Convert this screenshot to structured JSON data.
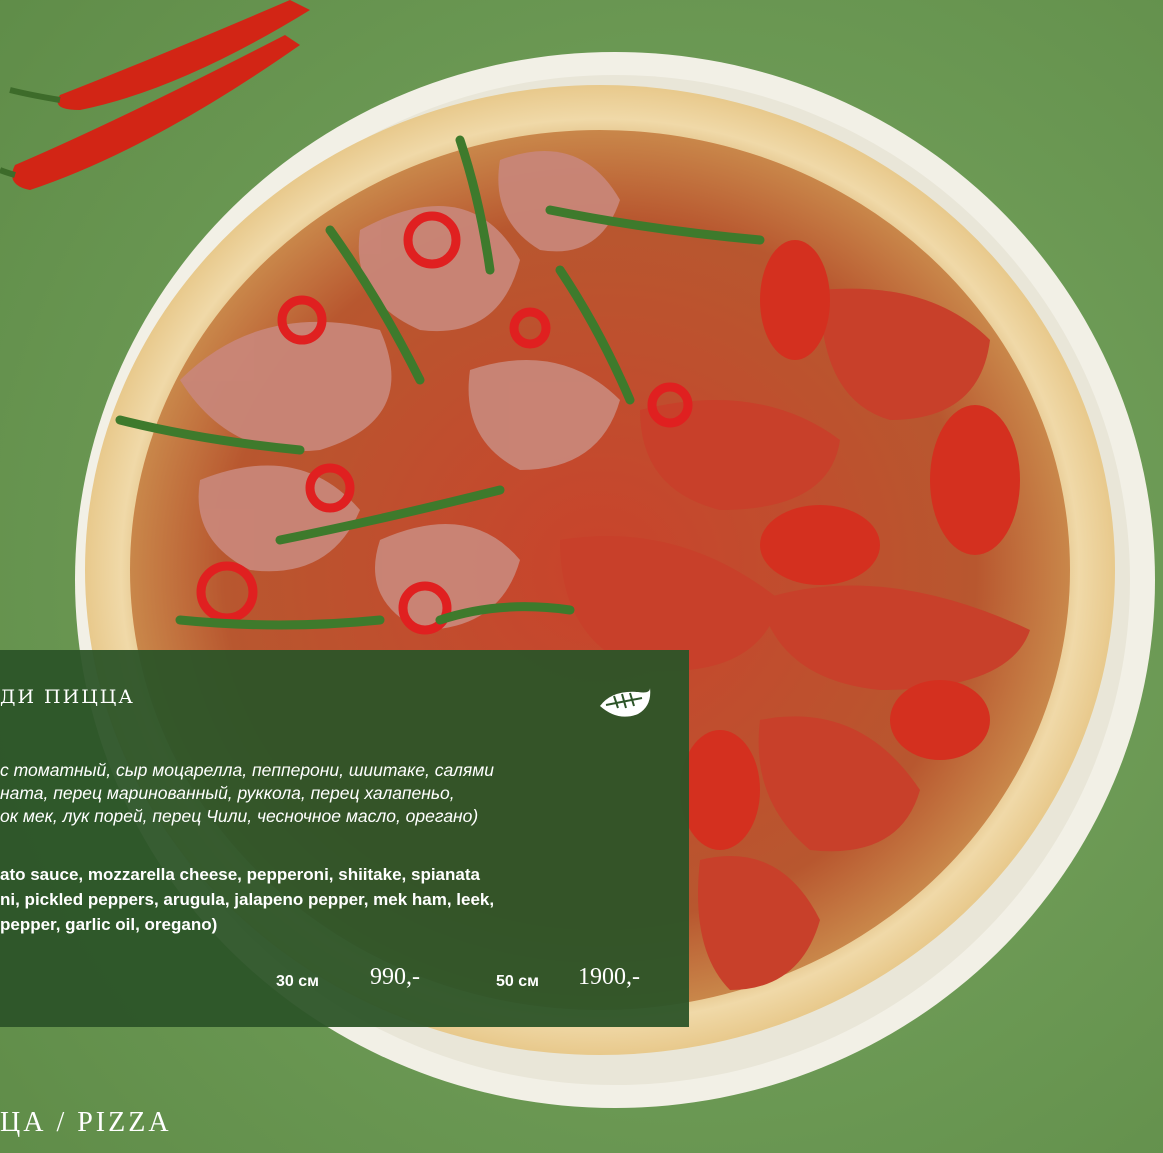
{
  "card": {
    "title": "ДИ ПИЦЦА",
    "leaf_icon": "leaf-icon",
    "description_ru": [
      "с томатный, сыр моцарелла, пепперони, шиитаке, салями",
      "ната, перец маринованный, руккола, перец халапеньо,",
      "ок мек, лук порей, перец Чили, чесночное масло, орегано)"
    ],
    "description_en": [
      "ato sauce, mozzarella cheese, pepperoni, shiitake, spianata",
      "ni, pickled peppers, arugula, jalapeno pepper, mek ham, leek,",
      "pepper, garlic oil, oregano)"
    ],
    "sizes": [
      {
        "label": "30 см",
        "price": "990,-"
      },
      {
        "label": "50 см",
        "price": "1900,-"
      }
    ]
  },
  "section_title": "ЦА / PIZZA",
  "colors": {
    "background_green": "#6e9a55",
    "card_green": "#2c5428",
    "text": "#ffffff"
  }
}
